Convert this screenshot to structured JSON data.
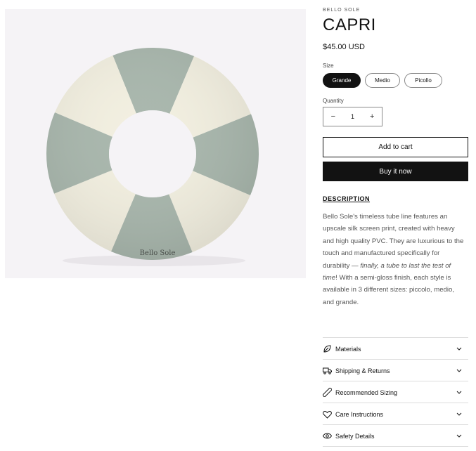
{
  "product": {
    "vendor": "BELLO SOLE",
    "title": "CAPRI",
    "price": "$45.00 USD",
    "image_logo_text": "Bello Sole"
  },
  "size": {
    "label": "Size",
    "options": [
      "Grande",
      "Medio",
      "Picollo"
    ],
    "selected": "Grande"
  },
  "quantity": {
    "label": "Quantity",
    "value": "1",
    "minus": "−",
    "plus": "+"
  },
  "buttons": {
    "add_to_cart": "Add to cart",
    "buy_now": "Buy it now"
  },
  "description": {
    "heading": "DESCRIPTION",
    "part1": "Bello Sole's timeless tube line features an upscale silk screen print, created with heavy and high quality PVC. They are luxurious to the touch and manufactured specifically for durability — ",
    "italic": "finally, a tube to last the test of time",
    "part2": "! With a semi-gloss finish, each style is available in 3 different sizes: piccolo, medio, and grande."
  },
  "accordion": [
    {
      "label": "Materials",
      "icon": "leaf-icon"
    },
    {
      "label": "Shipping & Returns",
      "icon": "truck-icon"
    },
    {
      "label": "Recommended Sizing",
      "icon": "ruler-icon"
    },
    {
      "label": "Care Instructions",
      "icon": "heart-icon"
    },
    {
      "label": "Safety Details",
      "icon": "eye-icon"
    }
  ],
  "colors": {
    "ring_green": "#a9b7ad",
    "ring_cream": "#f2efe0",
    "background": "#f5f3f6",
    "button_dark": "#121212"
  }
}
